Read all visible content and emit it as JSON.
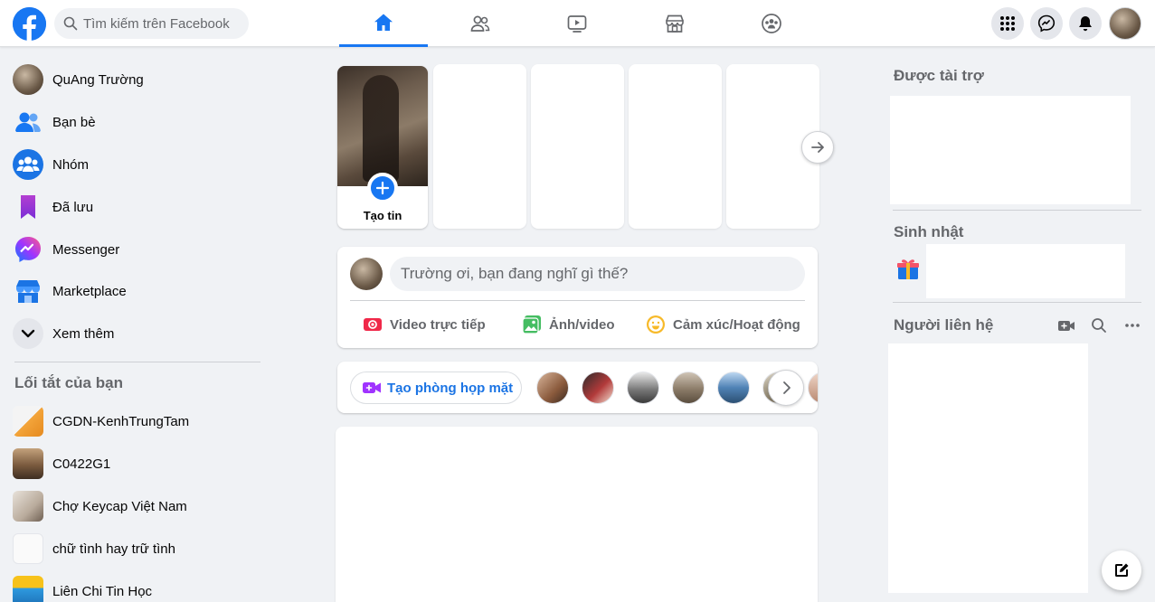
{
  "header": {
    "search_placeholder": "Tìm kiếm trên Facebook",
    "nav_tabs": [
      {
        "name": "home",
        "icon": "home-icon",
        "active": true
      },
      {
        "name": "friends",
        "icon": "friends-icon",
        "active": false
      },
      {
        "name": "watch",
        "icon": "watch-icon",
        "active": false
      },
      {
        "name": "marketplace",
        "icon": "marketplace-icon",
        "active": false
      },
      {
        "name": "groups",
        "icon": "groups-icon",
        "active": false
      }
    ],
    "right_icons": [
      "menu-grid-icon",
      "messenger-icon",
      "notifications-icon",
      "profile-avatar"
    ]
  },
  "sidebar": {
    "items": [
      {
        "label": "QuAng Trường",
        "icon": "profile-avatar"
      },
      {
        "label": "Bạn bè",
        "icon": "friends-icon"
      },
      {
        "label": "Nhóm",
        "icon": "groups-icon"
      },
      {
        "label": "Đã lưu",
        "icon": "bookmark-icon"
      },
      {
        "label": "Messenger",
        "icon": "messenger-icon"
      },
      {
        "label": "Marketplace",
        "icon": "marketplace-icon"
      },
      {
        "label": "Xem thêm",
        "icon": "chevron-down-icon"
      }
    ],
    "shortcuts_heading": "Lối tắt của bạn",
    "shortcuts": [
      {
        "label": "CGDN-KenhTrungTam"
      },
      {
        "label": "C0422G1"
      },
      {
        "label": "Chợ Keycap Việt Nam"
      },
      {
        "label": "chữ tình hay trữ tình"
      },
      {
        "label": "Liên Chi Tin Học"
      }
    ]
  },
  "stories": {
    "create_label": "Tạo tin"
  },
  "composer": {
    "prompt": "Trường ơi, bạn đang nghĩ gì thế?",
    "live_video": "Video trực tiếp",
    "photo_video": "Ảnh/video",
    "feeling": "Cảm xúc/Hoạt động"
  },
  "rooms": {
    "create_room": "Tạo phòng họp mặt"
  },
  "right": {
    "sponsored": "Được tài trợ",
    "birthdays": "Sinh nhật",
    "contacts": "Người liên hệ"
  },
  "colors": {
    "brand": "#1877f2",
    "background": "#f0f2f5",
    "secondary_text": "#65676b"
  }
}
